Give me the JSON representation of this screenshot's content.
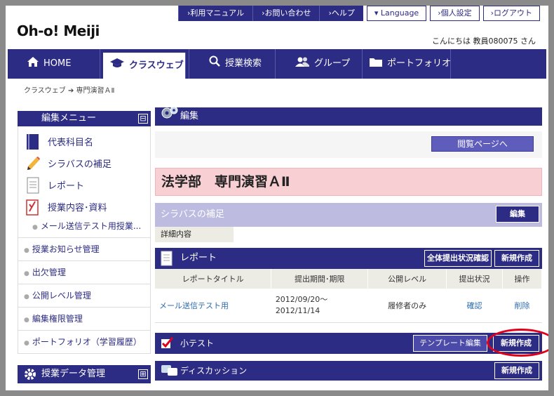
{
  "utility_links": [
    "›利用マニュアル",
    "›お問い合わせ",
    "›ヘルプ",
    "▾ Language",
    "›個人設定",
    "›ログアウト"
  ],
  "logo": "Oh-o! Meiji",
  "greeting": "こんにちは 教員080075 さん",
  "nav": {
    "home": "HOME",
    "classweb": "クラスウェブ",
    "search": "授業検索",
    "group": "グループ",
    "portfolio": "ポートフォリオ"
  },
  "breadcrumb": "クラスウェブ ➔ 専門演習ＡⅡ",
  "sidebar": {
    "edit_menu_title": "編集メニュー",
    "collapse": "⊟",
    "items": [
      "代表科目名",
      "シラバスの補足",
      "レポート",
      "授業内容･資料"
    ],
    "sub_item": "メール送信テスト用授業...",
    "links": [
      "授業お知らせ管理",
      "出欠管理",
      "公開レベル管理",
      "編集権限管理",
      "ポートフォリオ（学習履歴）"
    ],
    "data_mgmt_title": "授業データ管理",
    "expand": "⊞"
  },
  "content": {
    "edit_title": "編集",
    "view_page_button": "閲覧ページへ",
    "course_title": "法学部　専門演習ＡⅡ",
    "syllabus_title": "シラバスの補足",
    "syllabus_edit_button": "編集",
    "detail_label": "詳細内容",
    "report_title": "レポート",
    "report_status_button": "全体提出状況確認",
    "report_new_button": "新規作成",
    "report_columns": [
      "レポートタイトル",
      "提出期間･期限",
      "公開レベル",
      "提出状況",
      "操作"
    ],
    "report_row": {
      "title": "メール送信テスト用",
      "period": "2012/09/20～2012/11/14",
      "level": "履修者のみ",
      "status": "確認",
      "action": "削除"
    },
    "quiz_title": "小テスト",
    "quiz_template_button": "テンプレート編集",
    "quiz_new_button": "新規作成",
    "discussion_title": "ディスカッション",
    "discussion_new_button": "新規作成"
  },
  "colors": {
    "brand": "#2d2c84",
    "highlight_ring": "#e0001b",
    "title_bg": "#f8cfd3"
  }
}
